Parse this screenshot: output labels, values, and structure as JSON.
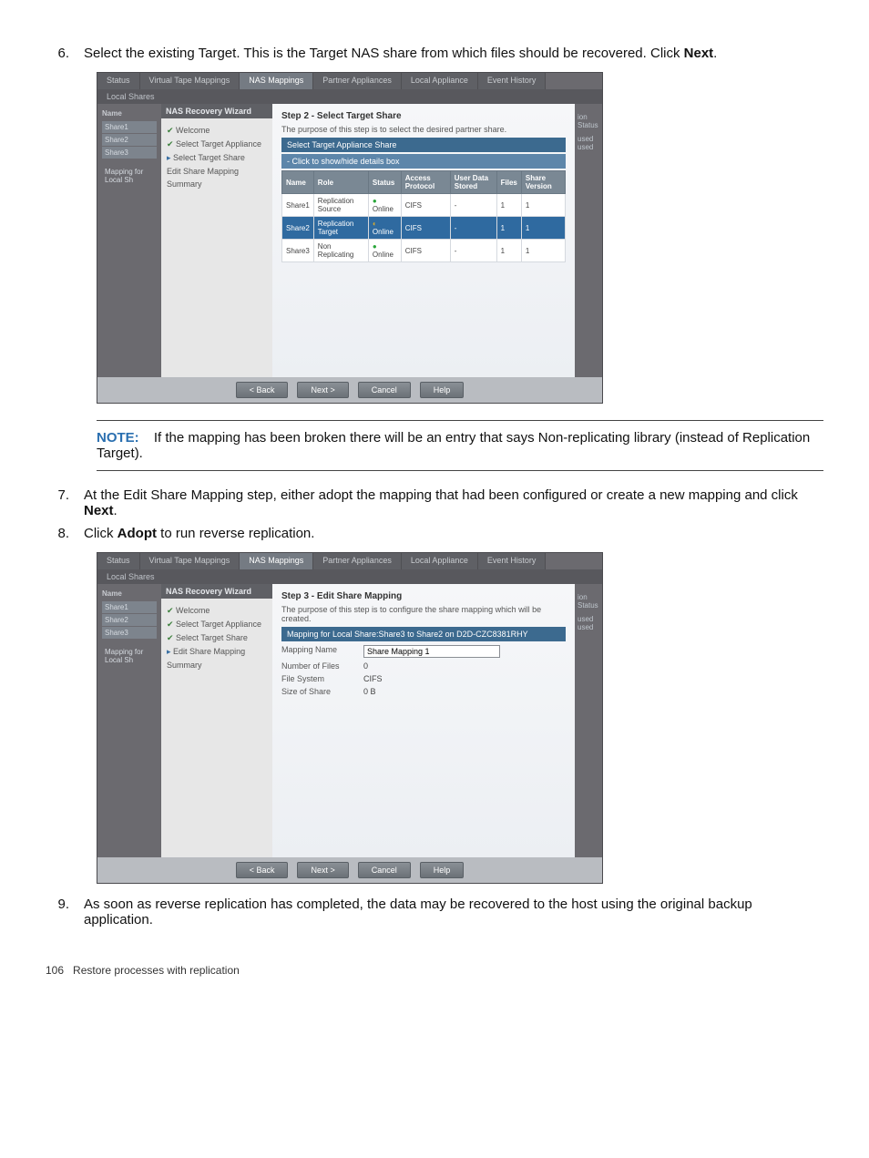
{
  "steps": {
    "s6_num": "6.",
    "s6_a": "Select the existing Target. This is the Target NAS share from which files should be recovered. Click ",
    "s6_b": "Next",
    "s6_c": ".",
    "s7_num": "7.",
    "s7_a": "At the Edit Share Mapping step, either adopt the mapping that had been configured or create a new mapping and click ",
    "s7_b": "Next",
    "s7_c": ".",
    "s8_num": "8.",
    "s8_a": "Click ",
    "s8_b": "Adopt",
    "s8_c": " to run reverse replication.",
    "s9_num": "9.",
    "s9_a": "As soon as reverse replication has completed, the data may be recovered to the host using the original backup application."
  },
  "note": {
    "label": "NOTE:",
    "text": "If the mapping has been broken there will be an entry that says Non-replicating library (instead of Replication Target)."
  },
  "tabs": [
    "Status",
    "Virtual Tape Mappings",
    "NAS Mappings",
    "Partner Appliances",
    "Local Appliance",
    "Event History"
  ],
  "active_tab_index": 2,
  "subtab": "Local Shares",
  "left_panel": {
    "header": "Name",
    "items": [
      "Share1",
      "Share2",
      "Share3"
    ],
    "footer": "Mapping for Local Sh"
  },
  "wizard_title": "NAS Recovery Wizard",
  "wizard_steps": {
    "done": [
      "Welcome",
      "Select Target Appliance"
    ],
    "done2_extra": "Select Target Share",
    "items_ss1": [
      {
        "label": "Welcome",
        "state": "done"
      },
      {
        "label": "Select Target Appliance",
        "state": "done"
      },
      {
        "label": "Select Target Share",
        "state": "cur"
      },
      {
        "label": "Edit Share Mapping",
        "state": ""
      },
      {
        "label": "Summary",
        "state": ""
      }
    ],
    "items_ss2": [
      {
        "label": "Welcome",
        "state": "done"
      },
      {
        "label": "Select Target Appliance",
        "state": "done"
      },
      {
        "label": "Select Target Share",
        "state": "done"
      },
      {
        "label": "Edit Share Mapping",
        "state": "cur"
      },
      {
        "label": "Summary",
        "state": ""
      }
    ]
  },
  "far_col": {
    "h": "ion Status",
    "a": "used",
    "b": "used"
  },
  "ss1": {
    "title": "Step 2 - Select Target Share",
    "desc": "The purpose of this step is to select the desired partner share.",
    "banner1": "Select Target Appliance Share",
    "banner2": "- Click to show/hide details box",
    "table": {
      "headers": [
        "Name",
        "Role",
        "Status",
        "Access Protocol",
        "User Data Stored",
        "Files",
        "Share Version"
      ],
      "rows": [
        {
          "cells": [
            "Share1",
            "Replication Source",
            "Online",
            "CIFS",
            "-",
            "1",
            "1"
          ],
          "sel": false,
          "load": false
        },
        {
          "cells": [
            "Share2",
            "Replication Target",
            "Online",
            "CIFS",
            "-",
            "1",
            "1"
          ],
          "sel": true,
          "load": true
        },
        {
          "cells": [
            "Share3",
            "Non Replicating",
            "Online",
            "CIFS",
            "-",
            "1",
            "1"
          ],
          "sel": false,
          "load": false
        }
      ]
    }
  },
  "ss2": {
    "title": "Step 3 - Edit Share Mapping",
    "desc": "The purpose of this step is to configure the share mapping which will be created.",
    "banner": "Mapping for Local Share:Share3 to Share2 on D2D-CZC8381RHY",
    "form": {
      "mapping_name_label": "Mapping Name",
      "mapping_name_value": "Share Mapping 1",
      "num_files_label": "Number of Files",
      "num_files_value": "0",
      "fs_label": "File System",
      "fs_value": "CIFS",
      "size_label": "Size of Share",
      "size_value": "0 B"
    }
  },
  "buttons": {
    "back": "< Back",
    "next": "Next >",
    "cancel": "Cancel",
    "help": "Help"
  },
  "footer": {
    "page": "106",
    "title": "Restore processes with replication"
  }
}
